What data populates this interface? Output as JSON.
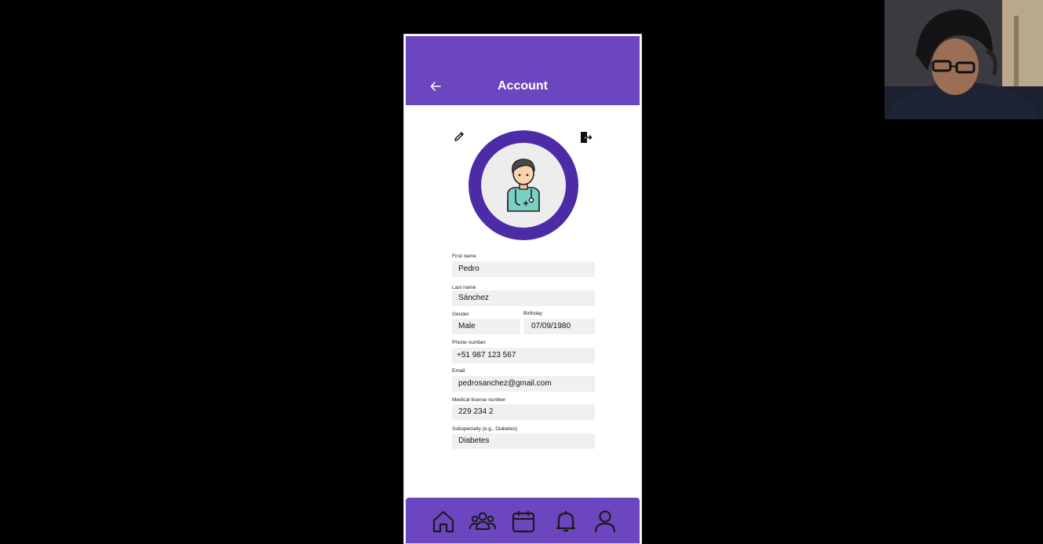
{
  "app": {
    "title": "Account",
    "accent_color": "#6c46bf",
    "ring_color": "#4b2ba6"
  },
  "header": {
    "back_icon": "arrow-left-icon",
    "title": "Account"
  },
  "profile": {
    "edit_icon": "pencil-icon",
    "logout_icon": "door-exit-icon",
    "avatar_icon": "doctor-avatar"
  },
  "form": {
    "first_name": {
      "label": "First name",
      "value": "Pedro"
    },
    "last_name": {
      "label": "Last name",
      "value": "Sánchez"
    },
    "gender": {
      "label": "Gender",
      "value": "Male"
    },
    "birthday": {
      "label": "Birthday",
      "value": "07/09/1980"
    },
    "phone": {
      "label": "Phone number",
      "value": "+51 987 123 567"
    },
    "email": {
      "label": "Email",
      "value": "pedrosanchez@gmail.com"
    },
    "license": {
      "label": "Medical license number",
      "value": "229 234 2"
    },
    "subspecialty": {
      "label": "Subspecialty (e.g., Diabetes)",
      "value": "Diabetes"
    }
  },
  "bottom_nav": {
    "items": [
      {
        "icon": "home-icon"
      },
      {
        "icon": "people-icon"
      },
      {
        "icon": "calendar-icon"
      },
      {
        "icon": "bell-icon"
      },
      {
        "icon": "user-icon"
      }
    ]
  }
}
